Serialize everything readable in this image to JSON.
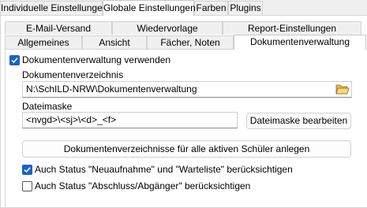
{
  "top_tabs": [
    {
      "label": "Individuelle Einstellungen",
      "active": false
    },
    {
      "label": "Globale Einstellungen",
      "active": true
    },
    {
      "label": "Farben",
      "active": false
    },
    {
      "label": "Plugins",
      "active": false
    }
  ],
  "sub_tabs_row1": [
    {
      "label": "E-Mail-Versand"
    },
    {
      "label": "Wiedervorlage"
    },
    {
      "label": "Report-Einstellungen"
    }
  ],
  "sub_tabs_row2": [
    {
      "label": "Allgemeines",
      "active": false
    },
    {
      "label": "Ansicht",
      "active": false
    },
    {
      "label": "Fächer, Noten",
      "active": false
    },
    {
      "label": "Dokumentenverwaltung",
      "active": true
    }
  ],
  "settings": {
    "use_document_management": {
      "label": "Dokumentenverwaltung verwenden",
      "checked": true
    },
    "directory": {
      "label": "Dokumentenverzeichnis",
      "value": "N:\\SchILD-NRW\\Dokumentenverwaltung",
      "browse_icon": "folder-open-icon"
    },
    "mask": {
      "label": "Dateimaske",
      "value": "<nvgd>\\<sj>\\<d>_<f>",
      "edit_button": "Dateimaske bearbeiten"
    },
    "create_dirs_button": "Dokumentenverzeichnisse für alle aktiven Schüler anlegen",
    "consider_new": {
      "label": "Auch Status \"Neuaufnahme\" und \"Warteliste\" berücksichtigen",
      "checked": true
    },
    "consider_graduates": {
      "label": "Auch Status \"Abschluss/Abgänger\" berücksichtigen",
      "checked": false
    }
  },
  "colors": {
    "accent": "#1a61c9",
    "window_bg": "#f0f0f0",
    "panel_bg": "#ffffff"
  }
}
